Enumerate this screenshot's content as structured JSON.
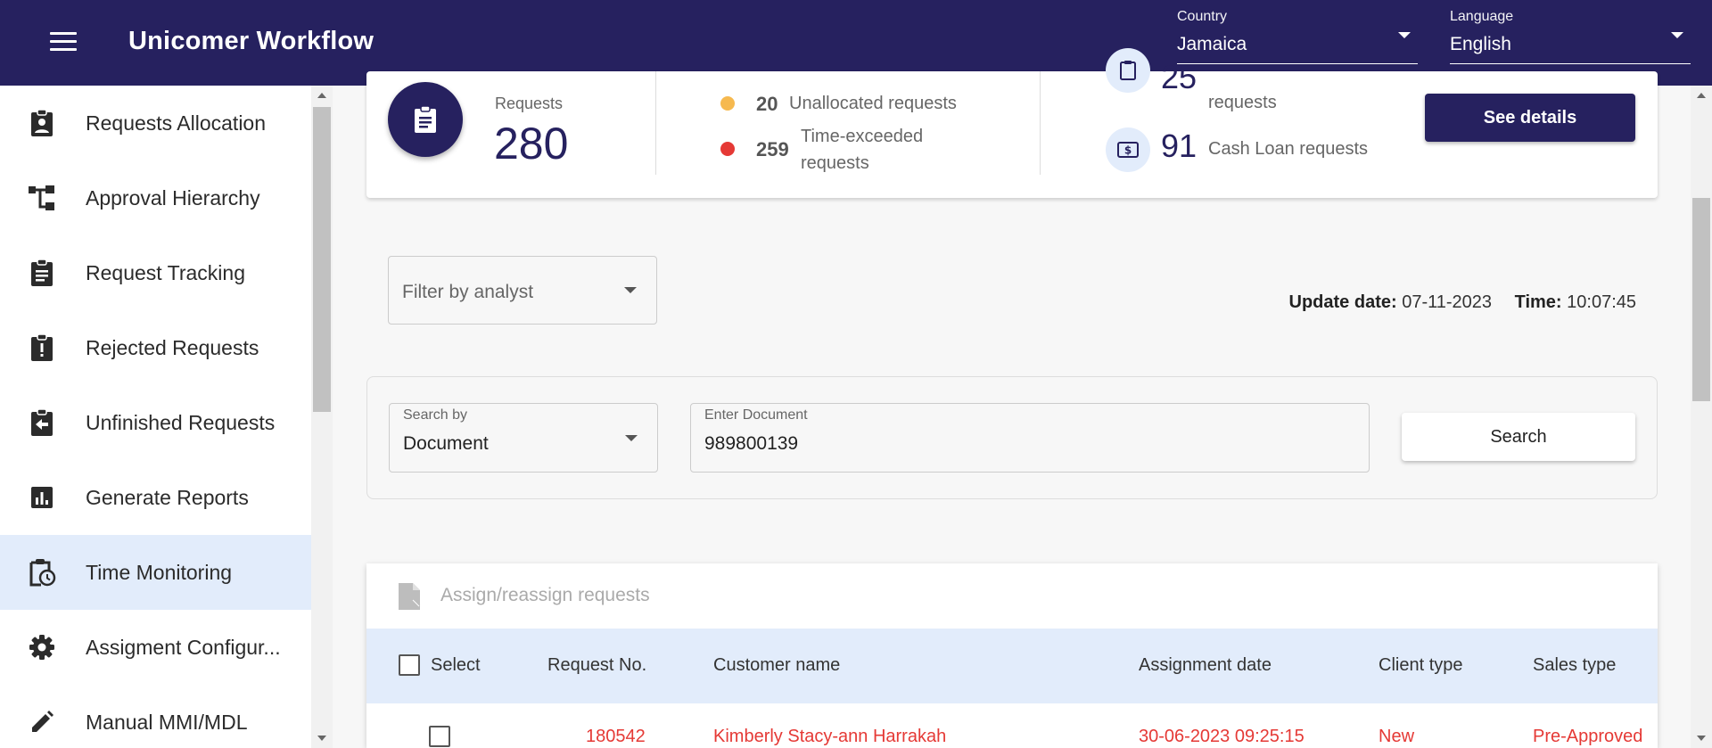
{
  "app": {
    "title": "Unicomer Workflow"
  },
  "header": {
    "country": {
      "label": "Country",
      "value": "Jamaica"
    },
    "language": {
      "label": "Language",
      "value": "English"
    }
  },
  "sidebar": {
    "items": [
      {
        "label": "Requests Allocation",
        "icon": "assignment-ind-icon",
        "active": false
      },
      {
        "label": "Approval Hierarchy",
        "icon": "account-tree-icon",
        "active": false
      },
      {
        "label": "Request Tracking",
        "icon": "clipboard-icon",
        "active": false
      },
      {
        "label": "Rejected Requests",
        "icon": "assignment-late-icon",
        "active": false
      },
      {
        "label": "Unfinished Requests",
        "icon": "assignment-return-icon",
        "active": false
      },
      {
        "label": "Generate Reports",
        "icon": "chart-icon",
        "active": false
      },
      {
        "label": "Time Monitoring",
        "icon": "pending-actions-icon",
        "active": true
      },
      {
        "label": "Assigment Configur...",
        "icon": "gear-icon",
        "active": false
      },
      {
        "label": "Manual MMI/MDL",
        "icon": "pencil-icon",
        "active": false
      }
    ]
  },
  "summary": {
    "requests_label": "Requests",
    "requests_total": "280",
    "unallocated": {
      "count": "20",
      "label": "Unallocated requests",
      "color": "#f6b94f"
    },
    "time_exceeded": {
      "count": "259",
      "label_line1": "Time-exceeded",
      "label_line2": "requests",
      "color": "#e53935"
    },
    "credit": {
      "count": "25",
      "label": "requests"
    },
    "cash_loan": {
      "count": "91",
      "label": "Cash Loan requests"
    },
    "see_details_label": "See details"
  },
  "filter": {
    "placeholder": "Filter by analyst"
  },
  "update": {
    "date_label": "Update date:",
    "date_value": "07-11-2023",
    "time_label": "Time:",
    "time_value": "10:07:45"
  },
  "search": {
    "search_by_label": "Search by",
    "search_by_value": "Document",
    "document_label": "Enter Document",
    "document_value": "989800139",
    "button_label": "Search"
  },
  "table": {
    "assign_label": "Assign/reassign requests",
    "headers": {
      "select": "Select",
      "request_no": "Request No.",
      "customer_name": "Customer name",
      "assignment_date": "Assignment date",
      "client_type": "Client type",
      "sales_type": "Sales type"
    },
    "rows": [
      {
        "request_no": "180542",
        "customer_name": "Kimberly Stacy-ann Harrakah",
        "assignment_date": "30-06-2023 09:25:15",
        "client_type": "New",
        "sales_type": "Pre-Approved"
      }
    ]
  },
  "colors": {
    "brand": "#26215f",
    "active_bg": "#e2ecfb",
    "alert_text": "#e53935"
  }
}
